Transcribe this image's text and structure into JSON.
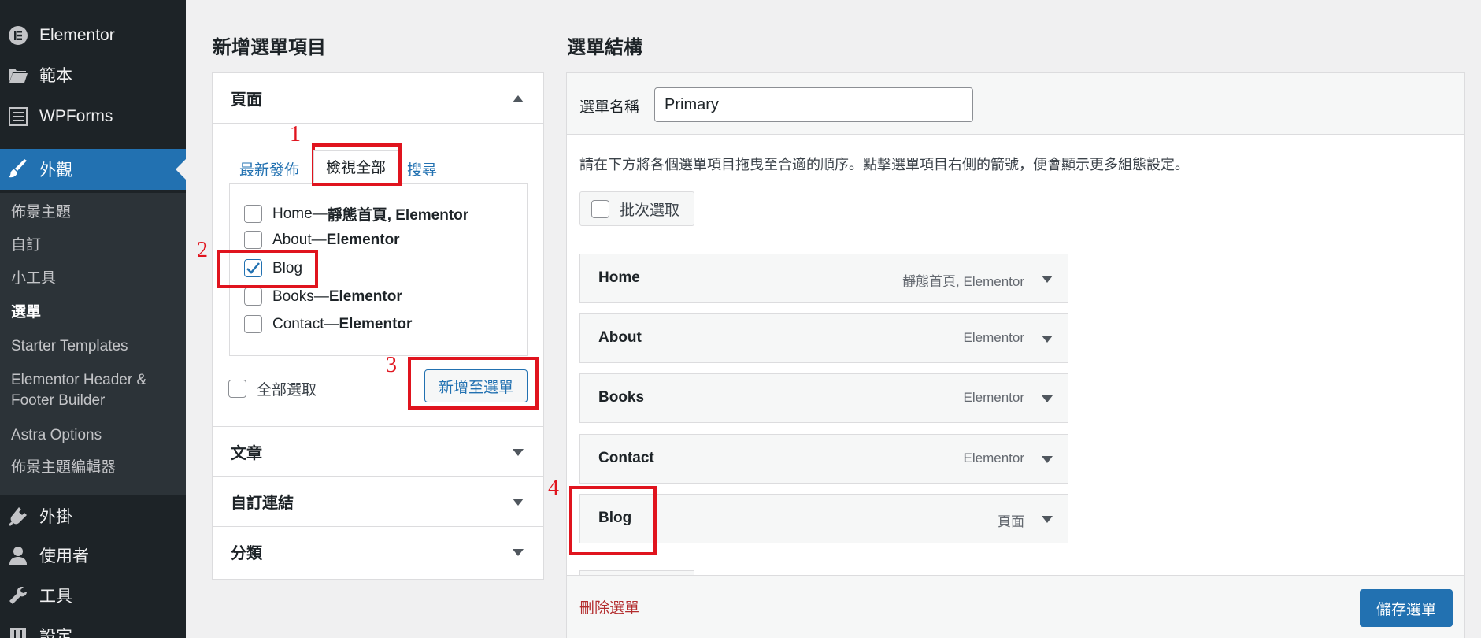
{
  "sidebar": {
    "items": [
      {
        "label": "Elementor",
        "icon": "elementor-icon"
      },
      {
        "label": "範本",
        "icon": "folder-icon"
      },
      {
        "label": "WPForms",
        "icon": "wpforms-icon"
      },
      {
        "label": "外觀",
        "icon": "paintbrush-icon",
        "active": true
      },
      {
        "label": "外掛",
        "icon": "plugin-icon"
      },
      {
        "label": "使用者",
        "icon": "user-icon"
      },
      {
        "label": "工具",
        "icon": "wrench-icon"
      },
      {
        "label": "設定",
        "icon": "settings-icon"
      }
    ],
    "submenu": [
      {
        "label": "佈景主題"
      },
      {
        "label": "自訂"
      },
      {
        "label": "小工具"
      },
      {
        "label": "選單",
        "current": true
      },
      {
        "label": "Starter Templates"
      },
      {
        "label": "Elementor Header & Footer Builder"
      },
      {
        "label": "Astra Options"
      },
      {
        "label": "佈景主題編輯器"
      }
    ]
  },
  "left": {
    "heading": "新增選單項目",
    "accordion": {
      "pages": "頁面",
      "posts": "文章",
      "custom_links": "自訂連結",
      "categories": "分類"
    },
    "tabs": {
      "recent": "最新發佈",
      "view_all": "檢視全部",
      "search": "搜尋"
    },
    "pages": [
      {
        "name": "Home",
        "sep": " — ",
        "meta": "靜態首頁, Elementor",
        "checked": false
      },
      {
        "name": "About",
        "sep": " — ",
        "meta": "Elementor",
        "checked": false
      },
      {
        "name": "Blog",
        "sep": "",
        "meta": "",
        "checked": true
      },
      {
        "name": "Books",
        "sep": " — ",
        "meta": "Elementor",
        "checked": false
      },
      {
        "name": "Contact",
        "sep": " — ",
        "meta": "Elementor",
        "checked": false
      }
    ],
    "select_all": "全部選取",
    "add_button": "新增至選單"
  },
  "right": {
    "heading": "選單結構",
    "menu_name_label": "選單名稱",
    "menu_name_value": "Primary",
    "instructions": "請在下方將各個選單項目拖曳至合適的順序。點擊選單項目右側的箭號，便會顯示更多組態設定。",
    "bulk_select": "批次選取",
    "items": [
      {
        "title": "Home",
        "type": "靜態首頁, Elementor"
      },
      {
        "title": "About",
        "type": "Elementor"
      },
      {
        "title": "Books",
        "type": "Elementor"
      },
      {
        "title": "Contact",
        "type": "Elementor"
      },
      {
        "title": "Blog",
        "type": "頁面"
      }
    ],
    "delete_menu": "刪除選單",
    "save_menu": "儲存選單"
  },
  "annotations": [
    "1",
    "2",
    "3",
    "4"
  ],
  "colors": {
    "accent": "#2271b1",
    "sidebar_bg": "#1d2327",
    "annotation": "#e0141e",
    "danger": "#b32d2e"
  }
}
